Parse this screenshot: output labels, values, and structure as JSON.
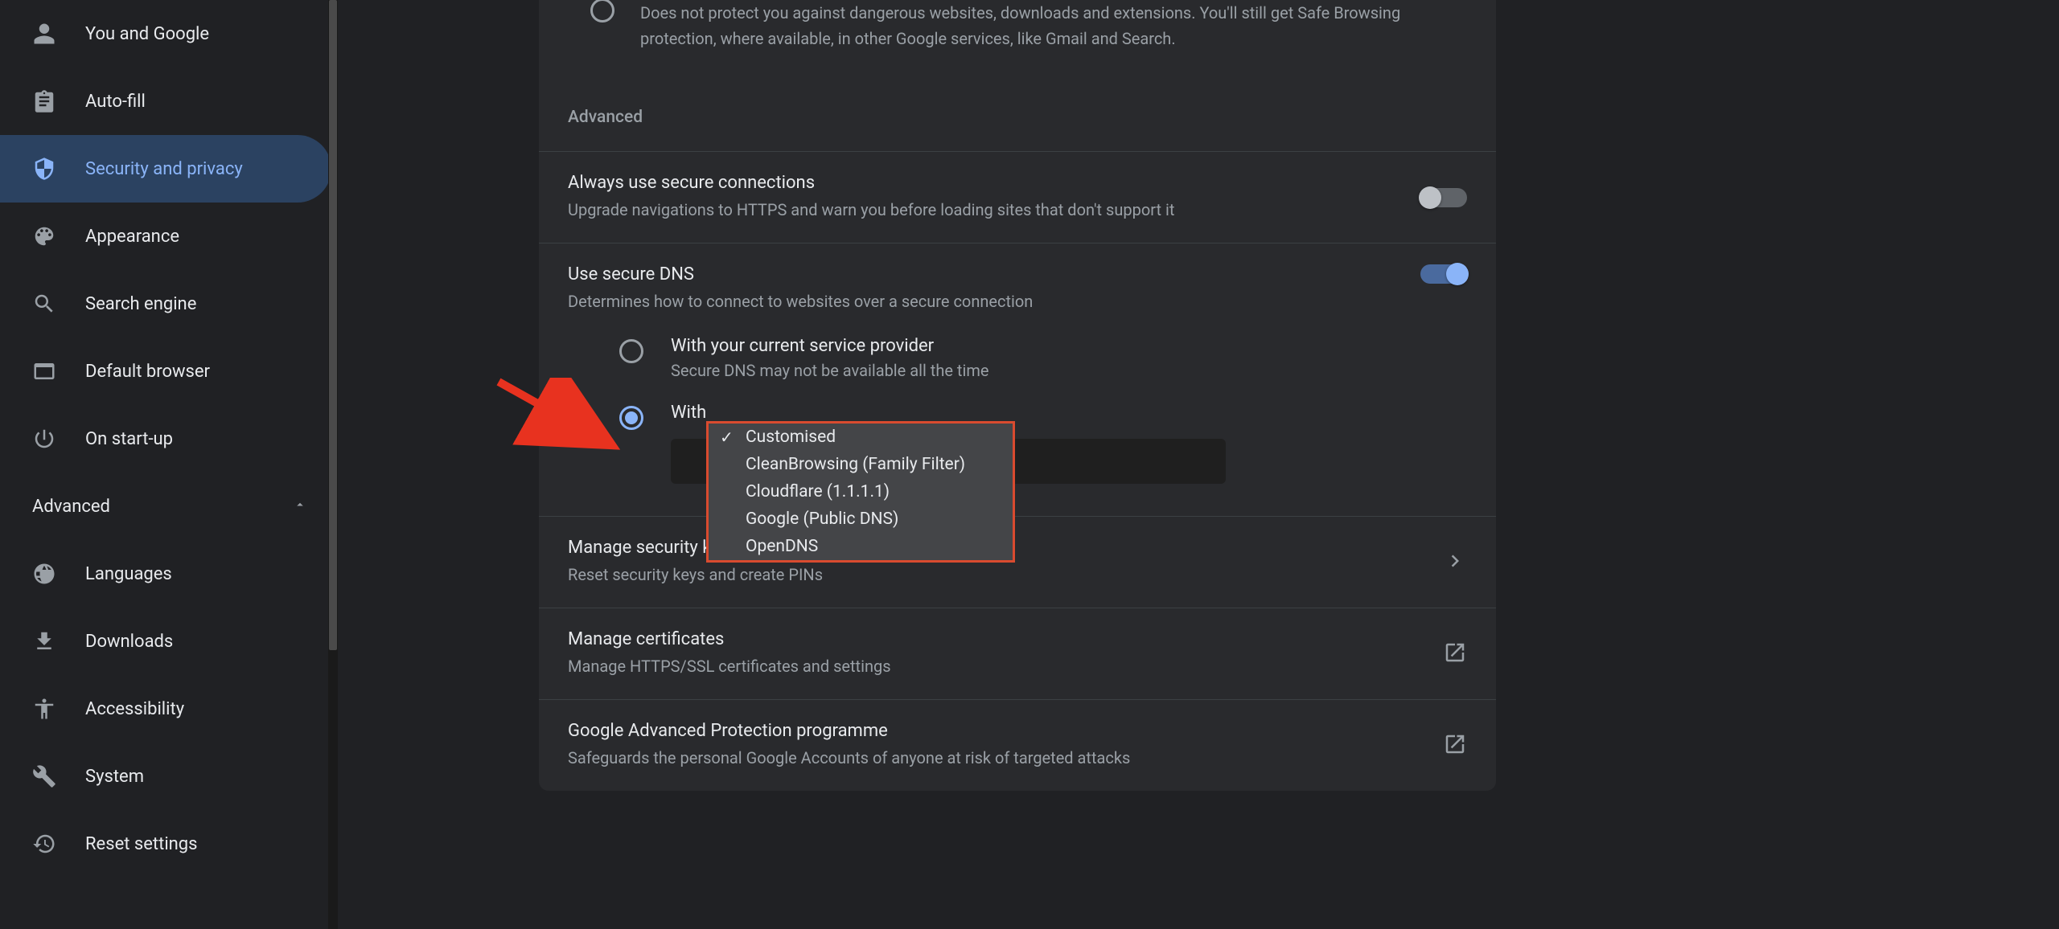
{
  "sidebar": {
    "items": [
      {
        "label": "You and Google",
        "icon": "person"
      },
      {
        "label": "Auto-fill",
        "icon": "clipboard"
      },
      {
        "label": "Security and privacy",
        "icon": "shield",
        "active": true
      },
      {
        "label": "Appearance",
        "icon": "palette"
      },
      {
        "label": "Search engine",
        "icon": "search"
      },
      {
        "label": "Default browser",
        "icon": "window"
      },
      {
        "label": "On start-up",
        "icon": "power"
      }
    ],
    "advanced_label": "Advanced",
    "advanced_items": [
      {
        "label": "Languages",
        "icon": "globe"
      },
      {
        "label": "Downloads",
        "icon": "download"
      },
      {
        "label": "Accessibility",
        "icon": "accessibility"
      },
      {
        "label": "System",
        "icon": "wrench"
      },
      {
        "label": "Reset settings",
        "icon": "restore"
      }
    ]
  },
  "main": {
    "partial_option_text": "Does not protect you against dangerous websites, downloads and extensions. You'll still get Safe Browsing protection, where available, in other Google services, like Gmail and Search.",
    "advanced_header": "Advanced",
    "secure_conn": {
      "title": "Always use secure connections",
      "subtitle": "Upgrade navigations to HTTPS and warn you before loading sites that don't support it",
      "enabled": false
    },
    "secure_dns": {
      "title": "Use secure DNS",
      "subtitle": "Determines how to connect to websites over a secure connection",
      "enabled": true,
      "opt_current": {
        "title": "With your current service provider",
        "subtitle": "Secure DNS may not be available all the time"
      },
      "opt_with": "With"
    },
    "dropdown": {
      "options": [
        "Customised",
        "CleanBrowsing (Family Filter)",
        "Cloudflare (1.1.1.1)",
        "Google (Public DNS)",
        "OpenDNS"
      ]
    },
    "manage_keys": {
      "title": "Manage security keys",
      "subtitle": "Reset security keys and create PINs"
    },
    "manage_certs": {
      "title": "Manage certificates",
      "subtitle": "Manage HTTPS/SSL certificates and settings"
    },
    "gapp": {
      "title": "Google Advanced Protection programme",
      "subtitle": "Safeguards the personal Google Accounts of anyone at risk of targeted attacks"
    }
  }
}
